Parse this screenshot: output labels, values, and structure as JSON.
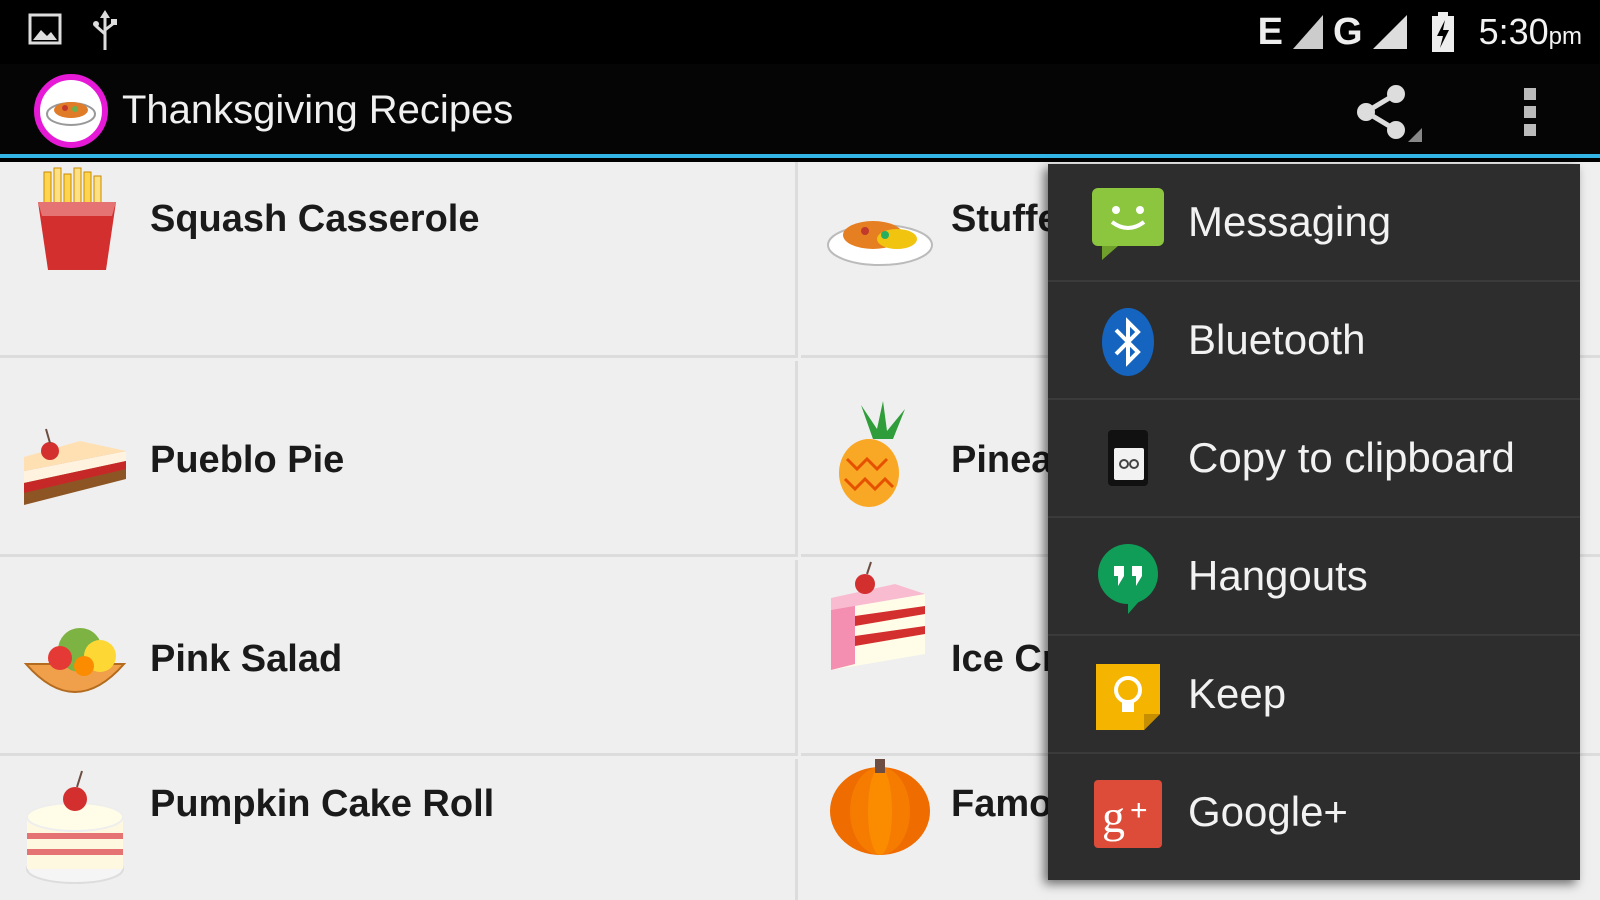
{
  "status_bar": {
    "network_1": "E",
    "network_2": "G",
    "time": "5:30",
    "time_suffix": "pm"
  },
  "action_bar": {
    "title": "Thanksgiving Recipes"
  },
  "recipes": [
    {
      "label": "Squash Casserole",
      "icon": "fries-icon"
    },
    {
      "label": "Stuffe",
      "icon": "plate-food-icon"
    },
    {
      "label": "Pueblo Pie",
      "icon": "pie-slice-icon"
    },
    {
      "label": "Pinea",
      "icon": "pineapple-icon"
    },
    {
      "label": "Pink Salad",
      "icon": "fruit-salad-icon"
    },
    {
      "label": "Ice Cr",
      "icon": "cake-slice-icon"
    },
    {
      "label": "Pumpkin Cake Roll",
      "icon": "cake-icon"
    },
    {
      "label": "Famo",
      "icon": "pumpkin-icon"
    }
  ],
  "share_menu": {
    "items": [
      {
        "label": "Messaging",
        "icon": "messaging-icon",
        "color": "#8cc63f"
      },
      {
        "label": "Bluetooth",
        "icon": "bluetooth-icon",
        "color": "#1565c0"
      },
      {
        "label": "Copy to clipboard",
        "icon": "clipboard-icon",
        "color": "#222222"
      },
      {
        "label": "Hangouts",
        "icon": "hangouts-icon",
        "color": "#0f9d58"
      },
      {
        "label": "Keep",
        "icon": "keep-icon",
        "color": "#f4b400"
      },
      {
        "label": "Google+",
        "icon": "google-plus-icon",
        "color": "#dd4b39"
      }
    ]
  },
  "colors": {
    "accent": "#33b5e5",
    "app_icon_ring": "#e61ad6"
  }
}
